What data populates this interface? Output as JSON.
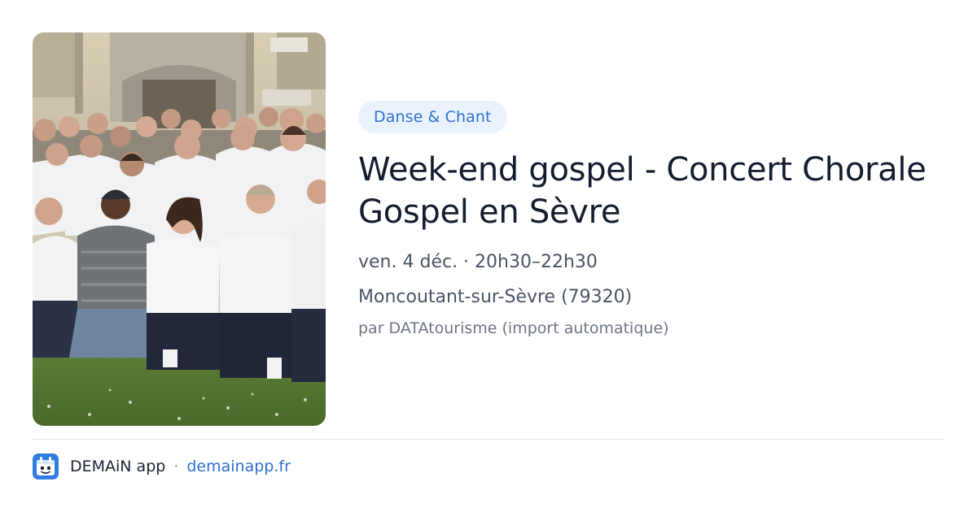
{
  "event": {
    "category": "Danse & Chant",
    "title": "Week-end gospel - Concert Chorale Gospel en Sèvre",
    "datetime": "ven. 4 déc. · 20h30–22h30",
    "location": "Moncoutant-sur-Sèvre (79320)",
    "source": "par DATAtourisme (import automatique)"
  },
  "footer": {
    "app_name": "DEMAiN app",
    "separator": "·",
    "domain": "demainapp.fr",
    "icon": "demain-app-icon"
  },
  "colors": {
    "badge_bg": "#eaf2fd",
    "accent": "#2f6fd1",
    "title": "#141d2f",
    "body_text": "#4a5466",
    "muted_text": "#6c7584",
    "divider": "#dfe3e9"
  }
}
